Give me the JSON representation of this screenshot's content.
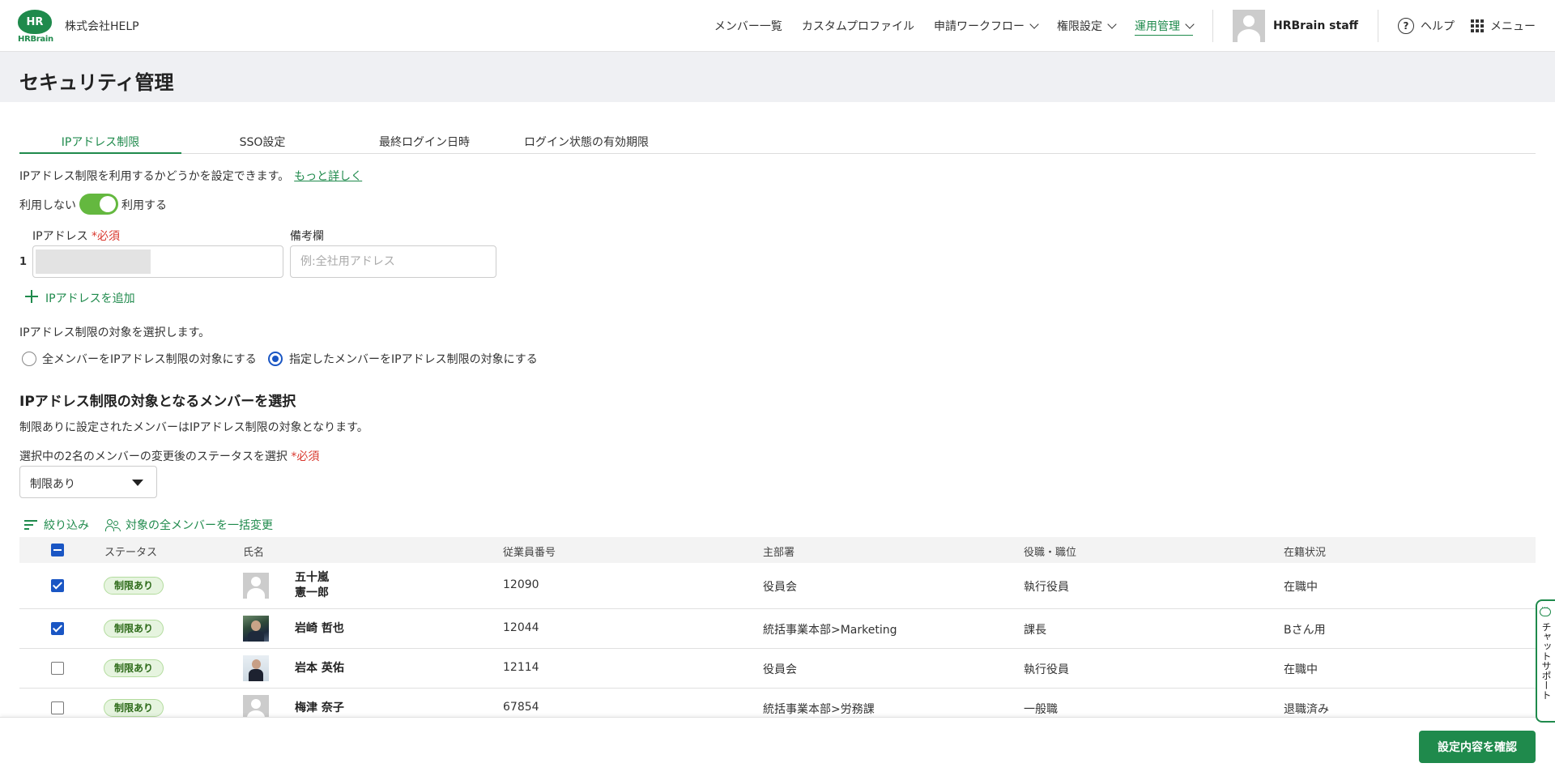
{
  "header": {
    "logo_mark": "HR",
    "logo_text": "HRBrain",
    "company": "株式会社HELP",
    "nav": [
      {
        "label": "メンバー一覧"
      },
      {
        "label": "カスタムプロファイル"
      },
      {
        "label": "申請ワークフロー"
      },
      {
        "label": "権限設定"
      },
      {
        "label": "運用管理"
      }
    ],
    "user_name": "HRBrain staff",
    "help": "ヘルプ",
    "menu": "メニュー"
  },
  "page_title": "セキュリティ管理",
  "tabs": [
    "IPアドレス制限",
    "SSO設定",
    "最終ログイン日時",
    "ログイン状態の有効期限"
  ],
  "ip": {
    "description": "IPアドレス制限を利用するかどうかを設定できます。",
    "more_link": "もっと詳しく",
    "toggle_off": "利用しない",
    "toggle_on": "利用する",
    "address_label": "IPアドレス",
    "required": "*必須",
    "note_label": "備考欄",
    "row_number": "1",
    "note_placeholder": "例:全社用アドレス",
    "add_label": "IPアドレスを追加",
    "target_prompt": "IPアドレス制限の対象を選択します。",
    "option_all": "全メンバーをIPアドレス制限の対象にする",
    "option_specified": "指定したメンバーをIPアドレス制限の対象にする"
  },
  "members": {
    "section_title": "IPアドレス制限の対象となるメンバーを選択",
    "section_desc": "制限ありに設定されたメンバーはIPアドレス制限の対象となります。",
    "status_prompt": "選択中の2名のメンバーの変更後のステータスを選択",
    "required": "*必須",
    "status_select": "制限あり",
    "filter_label": "絞り込み",
    "bulk_label": "対象の全メンバーを一括変更",
    "columns": [
      "ステータス",
      "氏名",
      "従業員番号",
      "主部署",
      "役職・職位",
      "在籍状況"
    ],
    "rows": [
      {
        "status": "制限あり",
        "name": "五十嵐\n憲一郎",
        "employee_no": "12090",
        "department": "役員会",
        "position": "執行役員",
        "enrollment": "在職中"
      },
      {
        "status": "制限あり",
        "name": "岩崎 哲也",
        "employee_no": "12044",
        "department": "統括事業本部>Marketing",
        "position": "課長",
        "enrollment": "Bさん用"
      },
      {
        "status": "制限あり",
        "name": "岩本 英佑",
        "employee_no": "12114",
        "department": "役員会",
        "position": "執行役員",
        "enrollment": "在職中"
      },
      {
        "status": "制限あり",
        "name": "梅津 奈子",
        "employee_no": "67854",
        "department": "統括事業本部>労務課",
        "position": "一般職",
        "enrollment": "退職済み"
      }
    ]
  },
  "footer": {
    "confirm": "設定内容を確認"
  },
  "chat_support": "チャットサポート",
  "colors": {
    "accent": "#1f8a4c",
    "toggle": "#64b83f",
    "checkbox": "#1a56c4",
    "required": "#d9382e"
  }
}
